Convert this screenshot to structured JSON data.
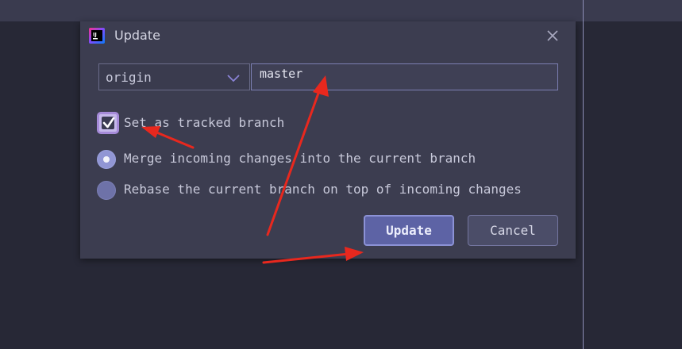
{
  "dialog": {
    "title": "Update",
    "app_icon": "intellij-idea-icon",
    "close_icon": "close-icon"
  },
  "remote": {
    "selected": "origin",
    "icon": "chevron-down-icon"
  },
  "branch": {
    "value": "master"
  },
  "tracked": {
    "label": "Set as tracked branch",
    "checked": true
  },
  "options": [
    {
      "label": "Merge incoming changes into the current branch",
      "selected": true
    },
    {
      "label": "Rebase the current branch on top of incoming changes",
      "selected": false
    }
  ],
  "buttons": {
    "update": "Update",
    "cancel": "Cancel"
  },
  "colors": {
    "accent": "#5d63a5",
    "annotation": "#e8281e",
    "background": "#272836",
    "dialog": "#3c3d50"
  }
}
